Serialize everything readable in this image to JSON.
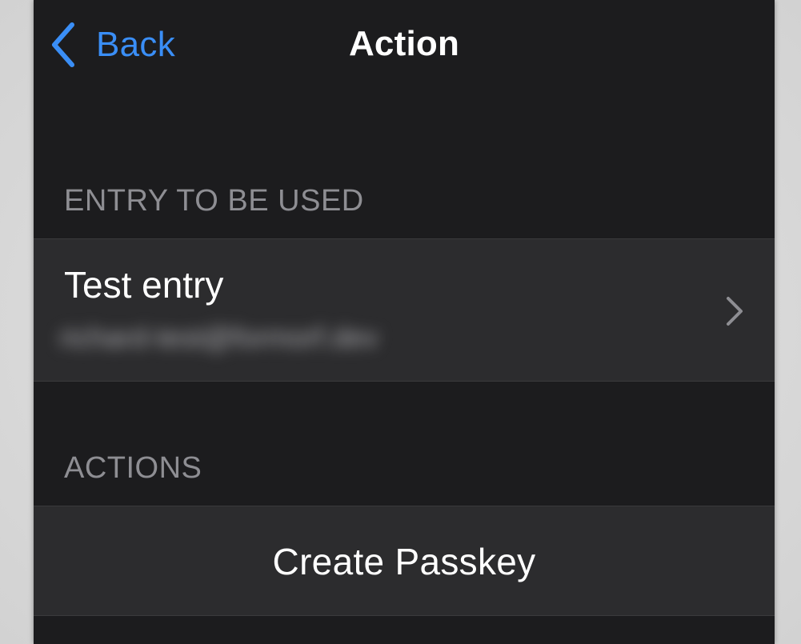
{
  "nav": {
    "back_label": "Back",
    "title": "Action"
  },
  "sections": {
    "entry_header": "ENTRY TO BE USED",
    "actions_header": "ACTIONS"
  },
  "entry": {
    "title": "Test entry",
    "subtitle": "richard-test@formorf.dev",
    "accessory_icon": "chevron-right-icon"
  },
  "actions": {
    "create_passkey_label": "Create Passkey"
  },
  "colors": {
    "background": "#1c1c1e",
    "cell_background": "#2c2c2e",
    "accent": "#3a8ef6",
    "secondary_text": "#8e8e93",
    "primary_text": "#ffffff"
  }
}
